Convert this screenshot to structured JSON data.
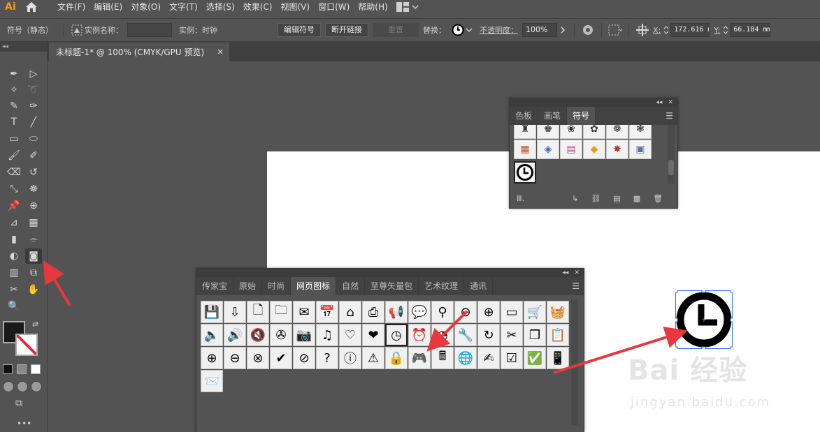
{
  "app": {
    "logo": "Ai"
  },
  "menubar": {
    "items": [
      "文件(F)",
      "编辑(E)",
      "对象(O)",
      "文字(T)",
      "选择(S)",
      "效果(C)",
      "视图(V)",
      "窗口(W)",
      "帮助(H)"
    ]
  },
  "controlbar": {
    "symbol_mode": "符号（静态）",
    "instance_name_label": "实例名称：",
    "instance_name_value": "",
    "instance_label": "实例：时钟",
    "edit_symbol": "编辑符号",
    "break_link": "断开链接",
    "reset": "重置",
    "replace_label": "替换：",
    "opacity_label": "不透明度：",
    "opacity_value": "100%",
    "x_label": "X:",
    "x_value": "172.616 m",
    "y_label": "Y:",
    "y_value": "66.184 mm"
  },
  "document": {
    "tab_title": "未标题-1* @ 100% (CMYK/GPU 预览)",
    "close": "×"
  },
  "symbols_panel": {
    "tabs": [
      "色板",
      "画笔",
      "符号"
    ],
    "active_tab": 2
  },
  "library_panel": {
    "tabs": [
      "传家宝",
      "原始",
      "时尚",
      "网页图标",
      "自然",
      "至尊矢量包",
      "艺术纹理",
      "通讯"
    ],
    "active_tab": 3
  },
  "watermark": {
    "brand": "Bai  经验",
    "url": "jingyan.baidu.com"
  },
  "colors": {
    "accent_arrow": "#e8383d",
    "selection": "#2f6bff"
  }
}
